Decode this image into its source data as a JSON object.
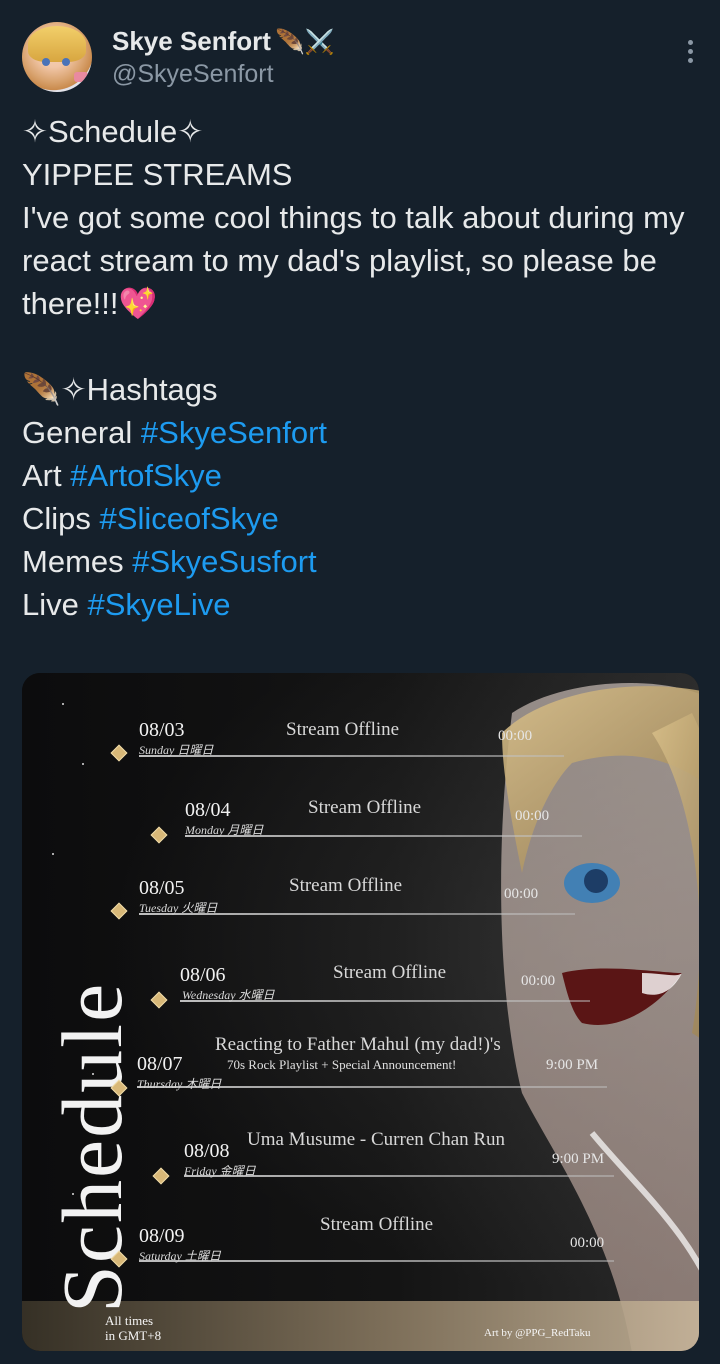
{
  "author": {
    "name": "Skye Senfort",
    "name_emoji": "🪶⚔️",
    "handle": "@SkyeSenfort"
  },
  "tweet": {
    "line1": "✧Schedule✧",
    "line2": "YIPPEE STREAMS",
    "line3": "I've got some cool things to talk about during my react stream to my dad's playlist, so please be there!!!💖",
    "hashtags_header": "🪶✧Hashtags",
    "hashtags": [
      {
        "label": "General",
        "tag": "#SkyeSenfort"
      },
      {
        "label": "Art",
        "tag": "#ArtofSkye"
      },
      {
        "label": "Clips",
        "tag": "#SliceofSkye"
      },
      {
        "label": "Memes",
        "tag": "#SkyeSusfort"
      },
      {
        "label": "Live",
        "tag": "#SkyeLive"
      }
    ]
  },
  "schedule": {
    "title": "Schedule",
    "rows": [
      {
        "date": "08/03",
        "day": "Sunday 日曜日",
        "event": "Stream Offline",
        "event2": "",
        "time": "00:00"
      },
      {
        "date": "08/04",
        "day": "Monday 月曜日",
        "event": "Stream Offline",
        "event2": "",
        "time": "00:00"
      },
      {
        "date": "08/05",
        "day": "Tuesday 火曜日",
        "event": "Stream Offline",
        "event2": "",
        "time": "00:00"
      },
      {
        "date": "08/06",
        "day": "Wednesday 水曜日",
        "event": "Stream Offline",
        "event2": "",
        "time": "00:00"
      },
      {
        "date": "08/07",
        "day": "Thursday 木曜日",
        "event": "Reacting to Father Mahul (my dad!)'s",
        "event2": "70s Rock Playlist + Special Announcement!",
        "time": "9:00 PM"
      },
      {
        "date": "08/08",
        "day": "Friday 金曜日",
        "event": "Uma Musume - Curren Chan Run",
        "event2": "",
        "time": "9:00 PM"
      },
      {
        "date": "08/09",
        "day": "Saturday 土曜日",
        "event": "Stream Offline",
        "event2": "",
        "time": "00:00"
      }
    ],
    "footer_times": "All times",
    "footer_tz": "in GMT+8",
    "credit": "Art by @PPG_RedTaku"
  },
  "colors": {
    "background": "#15202b",
    "link": "#1d9bf0",
    "secondary_text": "#8b98a5"
  }
}
